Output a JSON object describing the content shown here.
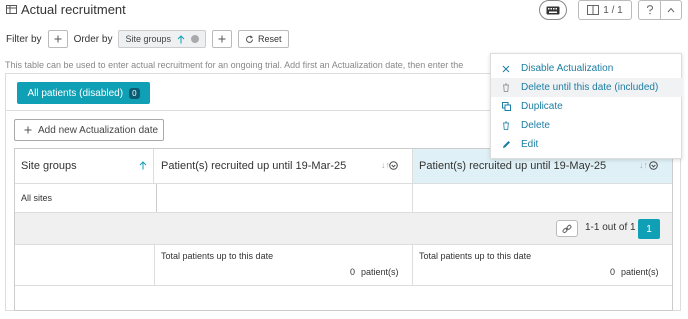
{
  "header": {
    "title": "Actual recruitment",
    "page_indicator": "1 / 1"
  },
  "filterbar": {
    "filter_label": "Filter by",
    "order_label": "Order by",
    "order_chip": "Site groups",
    "reset_label": "Reset"
  },
  "info_text": "This table can be used to enter actual recruitment for an ongoing trial. Add first an Actualization date, then enter the",
  "tab": {
    "label": "All patients (disabled)",
    "badge": "0"
  },
  "add_button_label": "Add new Actualization date",
  "table": {
    "col1_header": "Site groups",
    "col2_header": "Patient(s) recruited up until 19-Mar-25",
    "col3_header": "Patient(s) recruited up until 19-May-25",
    "row1_label": "All sites",
    "pagination_text": "1-1 out of 1",
    "page_number": "1",
    "total_label_1": "Total patients up to this date",
    "total_value_1": "0",
    "total_unit_1": "patient(s)",
    "total_label_2": "Total patients up to this date",
    "total_value_2": "0",
    "total_unit_2": "patient(s)"
  },
  "context_menu": {
    "items": [
      {
        "label": "Disable Actualization",
        "icon": "close-icon"
      },
      {
        "label": "Delete until this date (included)",
        "icon": "trash-icon"
      },
      {
        "label": "Duplicate",
        "icon": "copy-icon"
      },
      {
        "label": "Delete",
        "icon": "trash-icon"
      },
      {
        "label": "Edit",
        "icon": "pencil-icon"
      }
    ]
  },
  "colors": {
    "accent": "#0fa0b5",
    "link": "#1d7ea3",
    "highlight_column": "#dff1f6",
    "footer_band": "#f0f0f0"
  }
}
